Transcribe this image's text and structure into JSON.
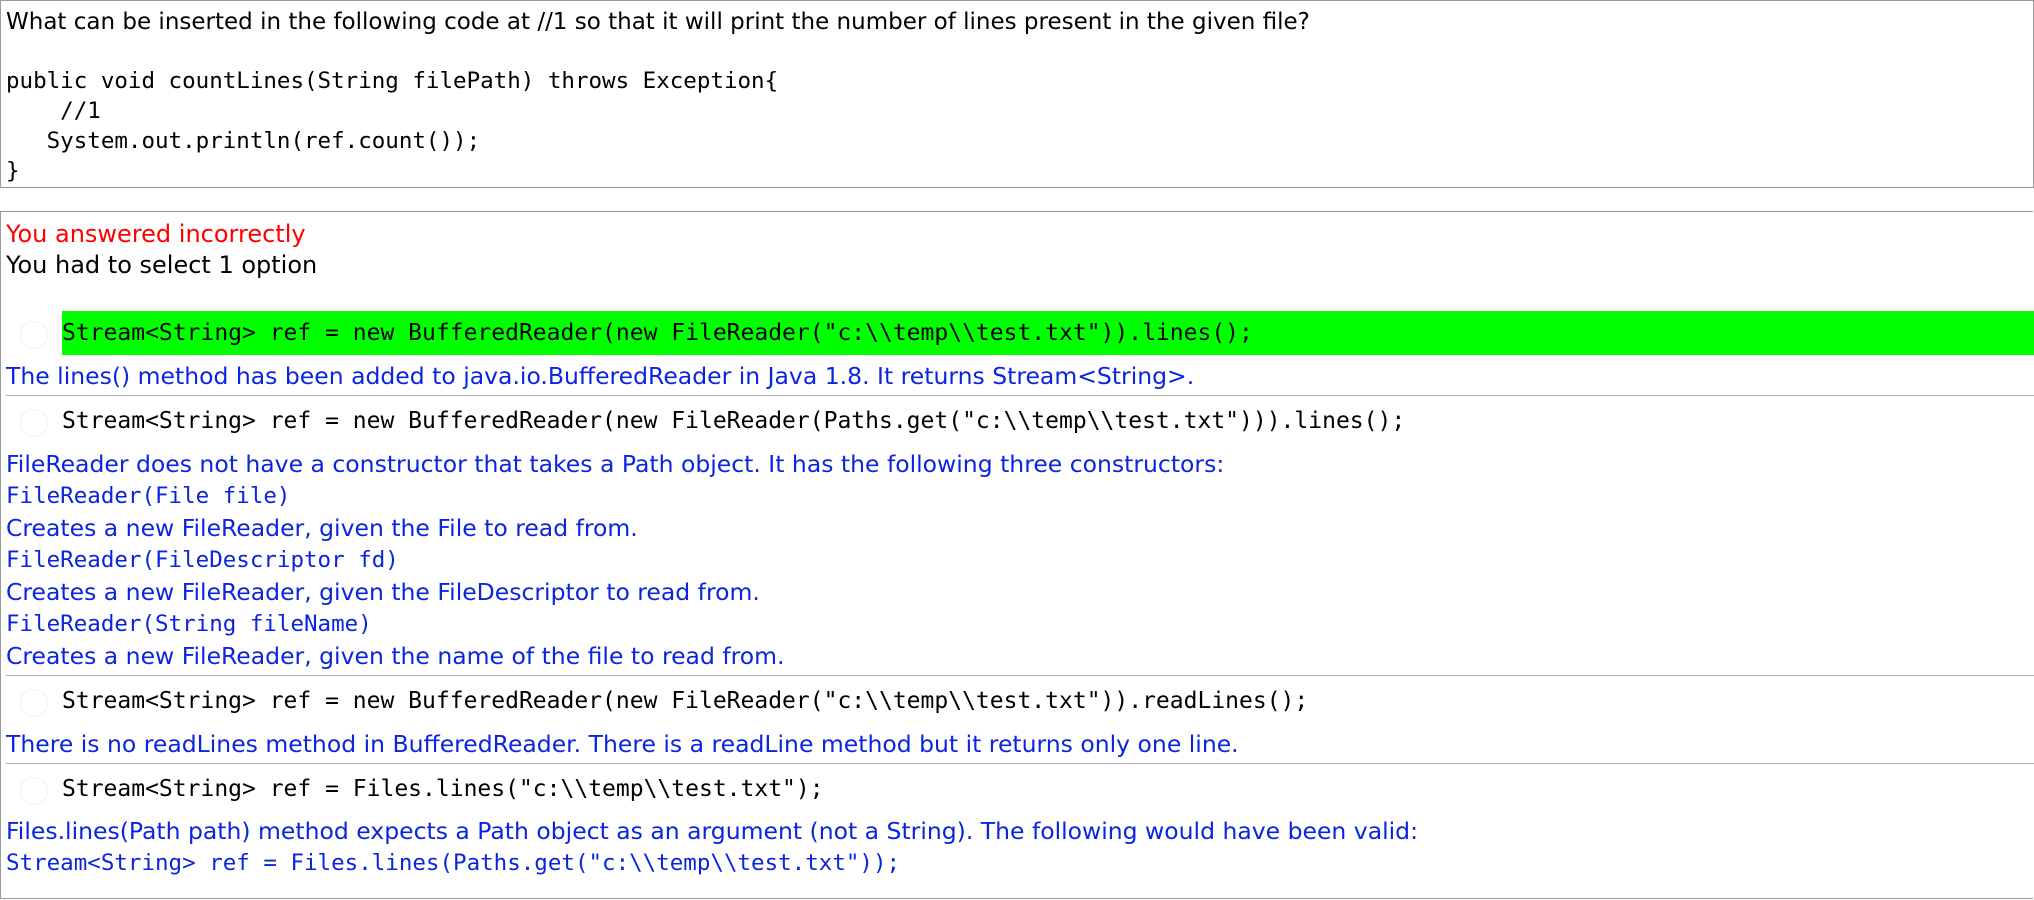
{
  "question": {
    "prompt": "What can be inserted in the following code at //1 so that it will print the number of lines present in the given file?",
    "code_lines": [
      "public void countLines(String filePath) throws Exception{",
      "    //1",
      "   System.out.println(ref.count());",
      "}"
    ]
  },
  "result": {
    "status": "You answered incorrectly",
    "instruction": "You had to select 1 option"
  },
  "options": [
    {
      "code": "Stream<String> ref = new BufferedReader(new FileReader(\"c:\\\\temp\\\\test.txt\")).lines();",
      "correct": true,
      "explanation": [
        "The lines() method has been added to java.io.BufferedReader in Java 1.8. It returns Stream<String>."
      ]
    },
    {
      "code": "Stream<String> ref = new BufferedReader(new FileReader(Paths.get(\"c:\\\\temp\\\\test.txt\"))).lines();",
      "correct": false,
      "explanation": [
        "FileReader does not have a constructor that takes a Path object. It has the following three constructors:",
        "FileReader(File file)",
        "Creates a new FileReader, given the File to read from.",
        "FileReader(FileDescriptor fd)",
        "Creates a new FileReader, given the FileDescriptor to read from.",
        "FileReader(String fileName)",
        "Creates a new FileReader, given the name of the file to read from."
      ]
    },
    {
      "code": "Stream<String> ref = new BufferedReader(new FileReader(\"c:\\\\temp\\\\test.txt\")).readLines();",
      "correct": false,
      "explanation": [
        "There is no readLines method in BufferedReader. There is a readLine method but it returns only one line."
      ]
    },
    {
      "code": "Stream<String> ref = Files.lines(\"c:\\\\temp\\\\test.txt\");",
      "correct": false,
      "explanation": [
        "Files.lines(Path path) method expects a Path object as an argument (not a String). The following would have been valid:",
        "Stream<String> ref = Files.lines(Paths.get(\"c:\\\\temp\\\\test.txt\"));"
      ]
    }
  ],
  "colors": {
    "correct_highlight": "#00ff00",
    "error_text": "#ff0000",
    "explanation_text": "#0a24e0"
  }
}
